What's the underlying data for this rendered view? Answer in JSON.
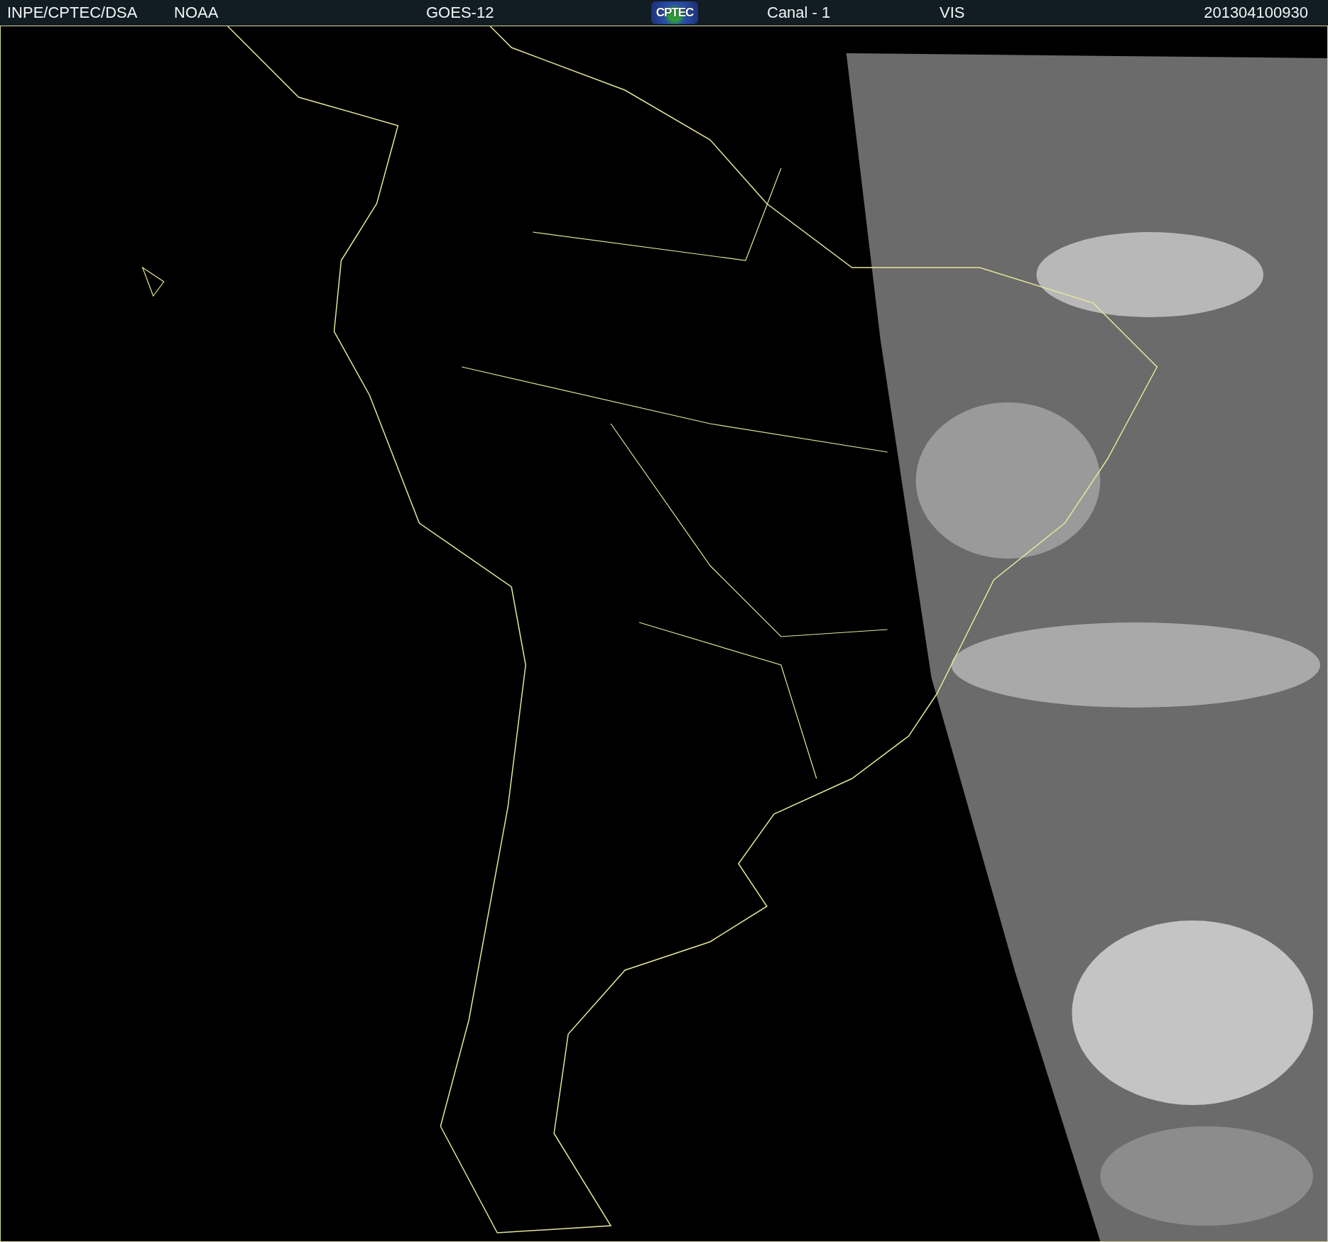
{
  "header": {
    "items": [
      {
        "kind": "text",
        "label": "INPE/CPTEC/DSA"
      },
      {
        "kind": "text",
        "label": "NOAA"
      },
      {
        "kind": "text",
        "label": "GOES-12"
      },
      {
        "kind": "logo",
        "label": "CPTEC"
      },
      {
        "kind": "text",
        "label": "Canal - 1"
      },
      {
        "kind": "text",
        "label": "VIS"
      },
      {
        "kind": "text",
        "label": "201304100930"
      }
    ]
  }
}
